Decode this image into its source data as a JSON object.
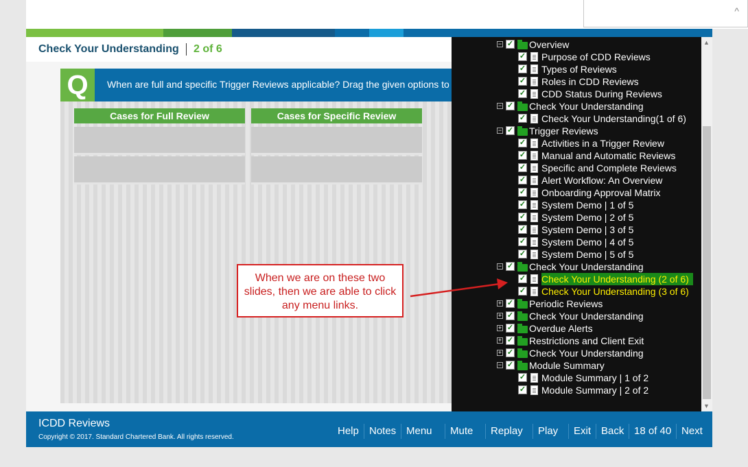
{
  "header": {
    "title": "Check Your Understanding",
    "progress": "2 of 6"
  },
  "strip_colors": [
    "#7bc043",
    "#4f9e3a",
    "#155a8a",
    "#0b6ca8",
    "#1a9ed9",
    "#0b6ca8"
  ],
  "question": {
    "badge": "Q",
    "text": "When are full and specific Trigger Reviews applicable? Drag the given options to the correct"
  },
  "columns": [
    {
      "label": "Cases for Full Review"
    },
    {
      "label": "Cases for Specific Review"
    }
  ],
  "menu": {
    "items": [
      {
        "label": "Overview",
        "type": "folder",
        "level": 0,
        "expander": "⊟"
      },
      {
        "label": "Purpose of CDD Reviews",
        "type": "page",
        "level": 1
      },
      {
        "label": "Types of Reviews",
        "type": "page",
        "level": 1
      },
      {
        "label": "Roles in CDD Reviews",
        "type": "page",
        "level": 1
      },
      {
        "label": "CDD Status During Reviews",
        "type": "page",
        "level": 1
      },
      {
        "label": "Check Your Understanding",
        "type": "folder",
        "level": 0,
        "expander": "⊟"
      },
      {
        "label": "Check Your Understanding(1 of 6)",
        "type": "page",
        "level": 1
      },
      {
        "label": "Trigger Reviews",
        "type": "folder",
        "level": 0,
        "expander": "⊟"
      },
      {
        "label": "Activities in a Trigger Review",
        "type": "page",
        "level": 1
      },
      {
        "label": "Manual and Automatic Reviews",
        "type": "page",
        "level": 1
      },
      {
        "label": "Specific and Complete Reviews",
        "type": "page",
        "level": 1
      },
      {
        "label": "Alert Workflow: An Overview",
        "type": "page",
        "level": 1
      },
      {
        "label": "Onboarding Approval Matrix",
        "type": "page",
        "level": 1
      },
      {
        "label": "System Demo | 1 of 5",
        "type": "page",
        "level": 1
      },
      {
        "label": "System Demo | 2 of 5",
        "type": "page",
        "level": 1
      },
      {
        "label": "System Demo | 3 of 5",
        "type": "page",
        "level": 1
      },
      {
        "label": "System Demo | 4 of 5",
        "type": "page",
        "level": 1
      },
      {
        "label": "System Demo | 5 of 5",
        "type": "page",
        "level": 1
      },
      {
        "label": "Check Your Understanding",
        "type": "folder",
        "level": 0,
        "expander": "⊟"
      },
      {
        "label": "Check Your Understanding (2 of 6)",
        "type": "page",
        "level": 1,
        "highlight": "active"
      },
      {
        "label": "Check Your Understanding (3 of 6)",
        "type": "page",
        "level": 1,
        "highlight": "yellow"
      },
      {
        "label": "Periodic Reviews",
        "type": "folder",
        "level": 0,
        "expander": "⊞"
      },
      {
        "label": "Check Your Understanding",
        "type": "folder",
        "level": 0,
        "expander": "⊞"
      },
      {
        "label": "Overdue Alerts",
        "type": "folder",
        "level": 0,
        "expander": "⊞"
      },
      {
        "label": "Restrictions and Client Exit",
        "type": "folder",
        "level": 0,
        "expander": "⊞"
      },
      {
        "label": "Check Your Understanding",
        "type": "folder",
        "level": 0,
        "expander": "⊞"
      },
      {
        "label": "Module Summary",
        "type": "folder",
        "level": 0,
        "expander": "⊟"
      },
      {
        "label": "Module Summary | 1 of 2",
        "type": "page",
        "level": 1
      },
      {
        "label": "Module Summary | 2 of 2",
        "type": "page",
        "level": 1
      }
    ]
  },
  "callout": {
    "text": "When we are on these two slides, then we are able to click any menu links."
  },
  "footer": {
    "app_title": "ICDD Reviews",
    "copyright": "Copyright © 2017. Standard Chartered Bank. All rights reserved.",
    "nav": [
      {
        "label": "Help"
      },
      {
        "label": "Notes"
      },
      {
        "label": "Menu"
      },
      {
        "label": "Mute"
      },
      {
        "label": "Replay"
      },
      {
        "label": "Play"
      },
      {
        "label": "Exit"
      },
      {
        "label": "Back"
      }
    ],
    "page_counter": "18 of 40",
    "next_label": "Next"
  },
  "colors": {
    "accent_green": "#5fb33b",
    "brand_blue": "#0b6ca8",
    "menu_bg": "#111111",
    "highlight": "#ffef00"
  }
}
